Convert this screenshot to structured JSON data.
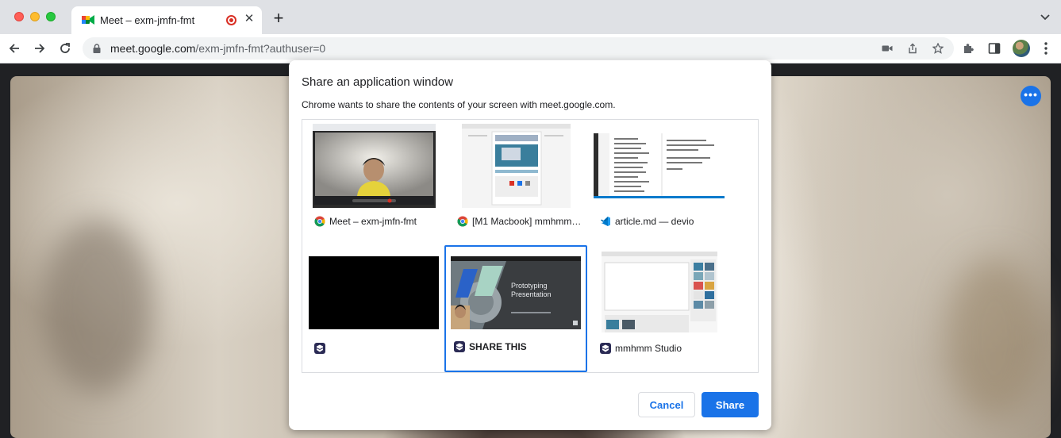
{
  "browser": {
    "tab": {
      "title": "Meet – exm-jmfn-fmt",
      "favicon": "google-meet-icon",
      "recording_indicator": "recording-icon"
    },
    "url": {
      "host": "meet.google.com",
      "path": "/exm-jmfn-fmt?authuser=0"
    }
  },
  "meeting": {
    "more_options": "•••"
  },
  "dialog": {
    "title": "Share an application window",
    "description": "Chrome wants to share the contents of your screen with meet.google.com.",
    "windows": [
      {
        "label": "Meet – exm-jmfn-fmt",
        "app_icon": "chrome-icon"
      },
      {
        "label": "[M1 Macbook] mmhmm…",
        "app_icon": "chrome-icon"
      },
      {
        "label": "article.md — devio",
        "app_icon": "vscode-icon"
      },
      {
        "label": "",
        "app_icon": "mmhmm-icon"
      },
      {
        "label": "SHARE THIS",
        "app_icon": "mmhmm-icon",
        "selected": true
      },
      {
        "label": "mmhmm Studio",
        "app_icon": "mmhmm-icon"
      }
    ],
    "preview_text": {
      "line1": "Prototyping",
      "line2": "Presentation"
    },
    "cancel_label": "Cancel",
    "share_label": "Share"
  },
  "colors": {
    "accent": "#1a73e8",
    "record": "#d93025"
  }
}
